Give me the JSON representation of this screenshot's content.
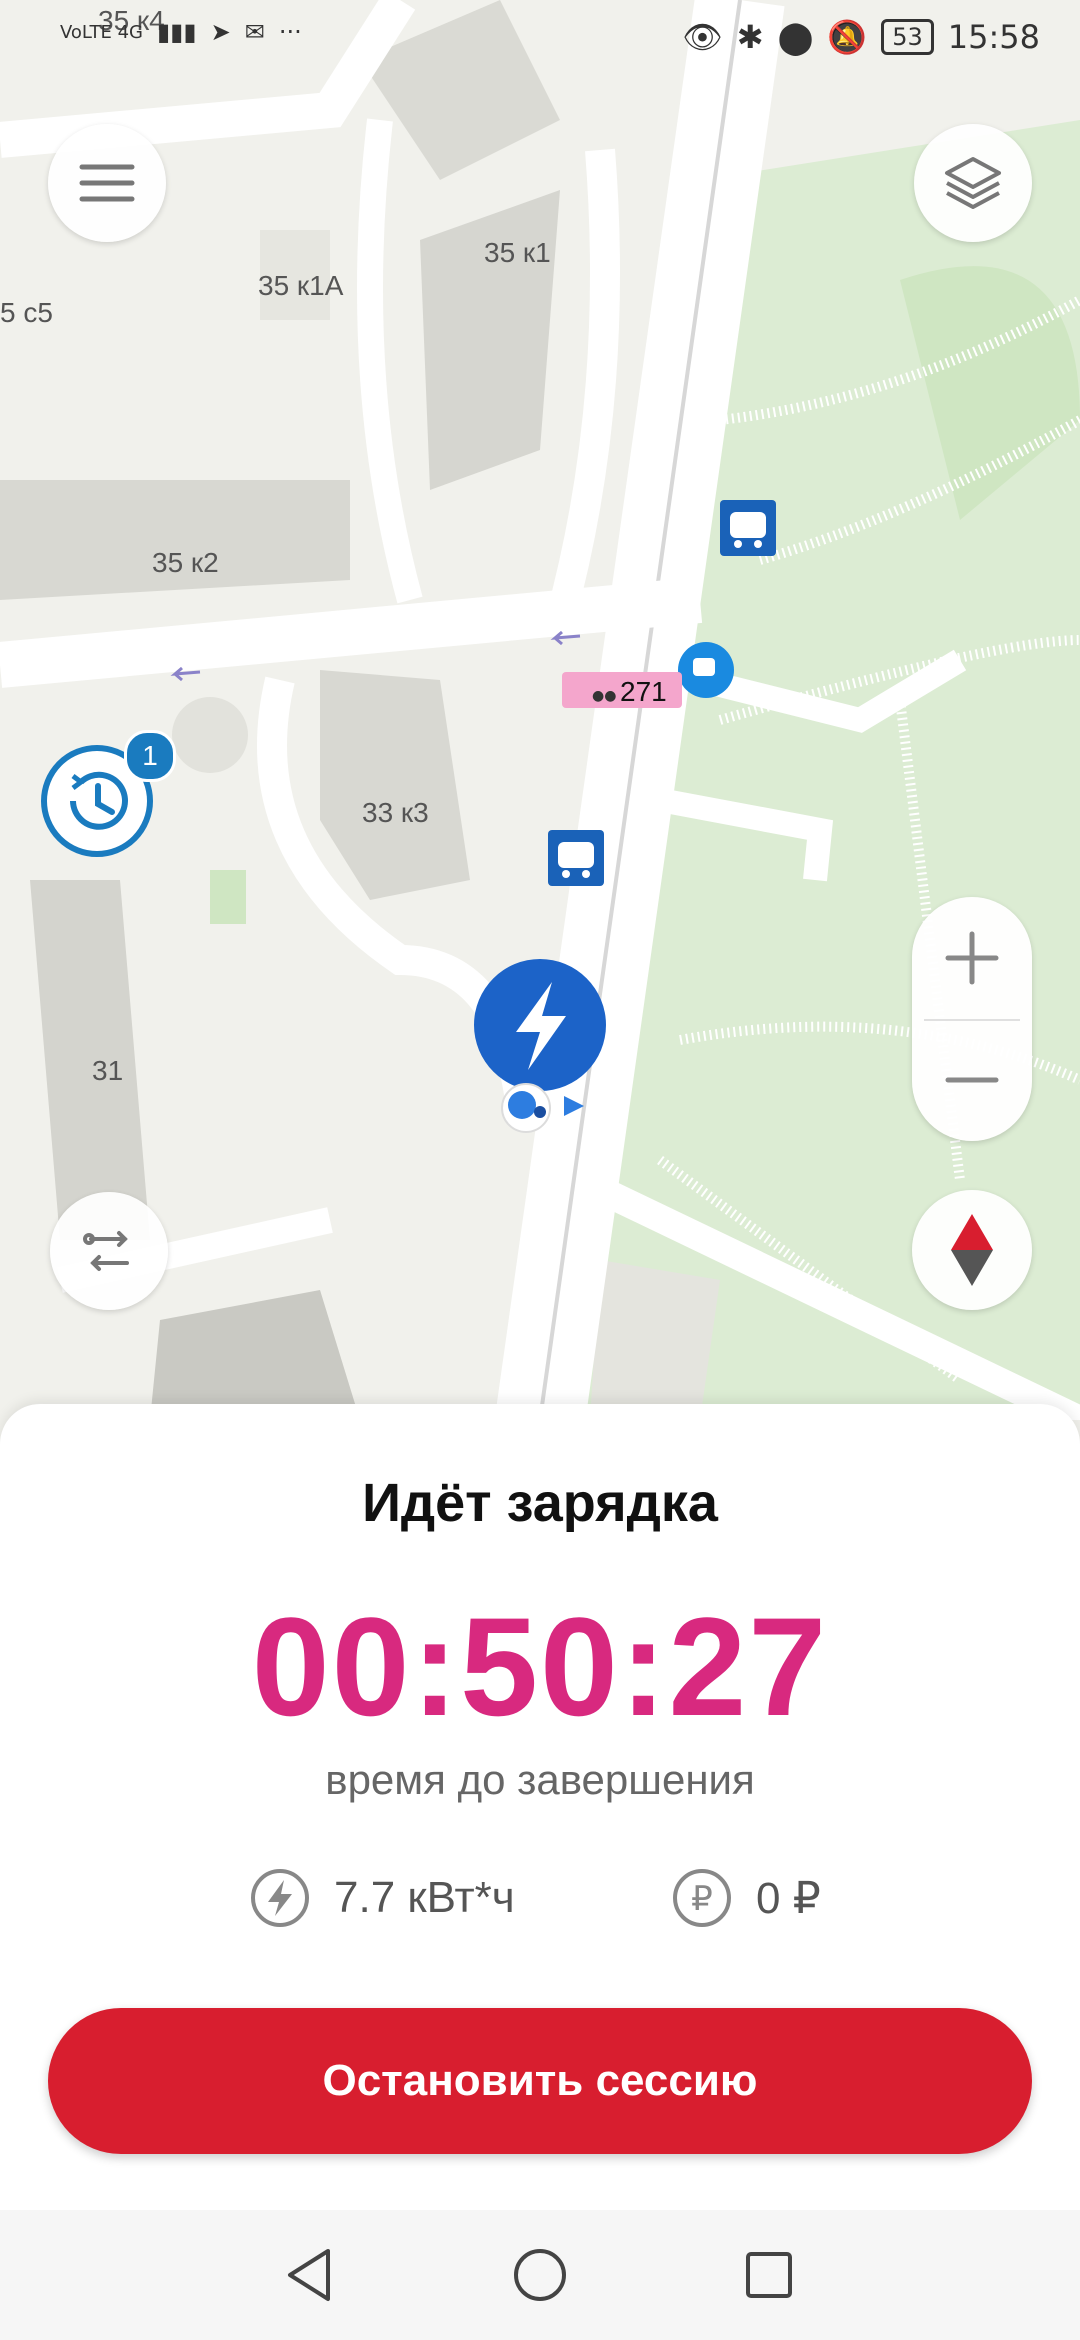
{
  "status_bar": {
    "time": "15:58",
    "battery": "53",
    "network": "VoLTE 4G"
  },
  "map": {
    "labels": {
      "b35k4": "35 к4",
      "b35k1": "35 к1",
      "b35k1a": "35 к1А",
      "b5c5": "5 с5",
      "b35k2": "35 к2",
      "b33k3": "33 к3",
      "b31": "31"
    },
    "bus_route": "271",
    "history_badge": "1"
  },
  "charging": {
    "title": "Идёт зарядка",
    "timer": "00:50:27",
    "subtitle": "время до завершения",
    "energy": "7.7 кВт*ч",
    "cost": "0 ₽",
    "stop_label": "Остановить сессию"
  },
  "colors": {
    "accent": "#d8297f",
    "stop_button": "#d81e2f",
    "marker": "#1c63c8"
  }
}
